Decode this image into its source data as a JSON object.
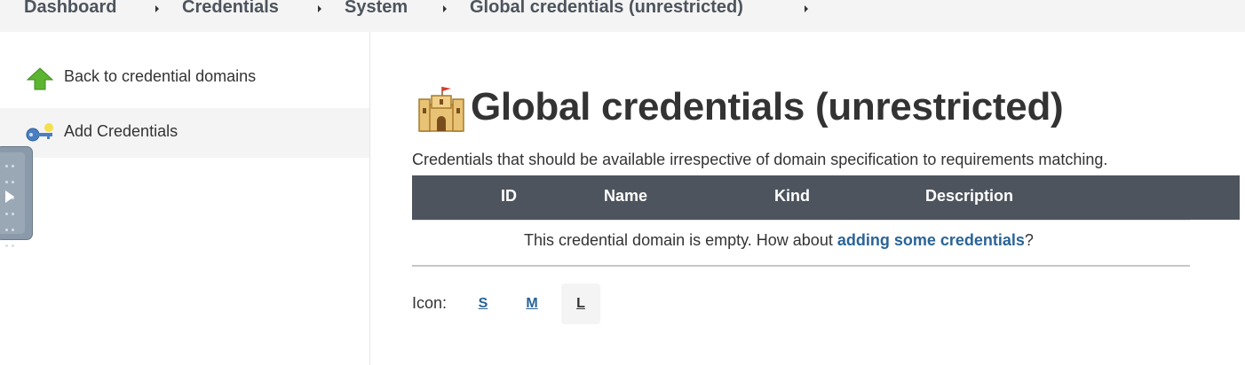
{
  "breadcrumbs": [
    {
      "label": "Dashboard"
    },
    {
      "label": "Credentials"
    },
    {
      "label": "System"
    },
    {
      "label": "Global credentials (unrestricted)"
    }
  ],
  "sidebar": {
    "items": [
      {
        "label": "Back to credential domains",
        "icon": "up-arrow-icon"
      },
      {
        "label": "Add Credentials",
        "icon": "key-icon"
      }
    ]
  },
  "page": {
    "title": "Global credentials (unrestricted)",
    "title_icon": "castle-icon",
    "description": "Credentials that should be available irrespective of domain specification to requirements matching."
  },
  "table": {
    "columns": [
      "ID",
      "Name",
      "Kind",
      "Description"
    ],
    "empty_prefix": "This credential domain is empty. How about ",
    "empty_link": "adding some credentials",
    "empty_suffix": "?"
  },
  "icon_size": {
    "label": "Icon:",
    "options": [
      "S",
      "M",
      "L"
    ],
    "selected": "L"
  },
  "colors": {
    "header_bg": "#4d545d",
    "link": "#2a6496",
    "active_bg": "#f4f4f4"
  }
}
